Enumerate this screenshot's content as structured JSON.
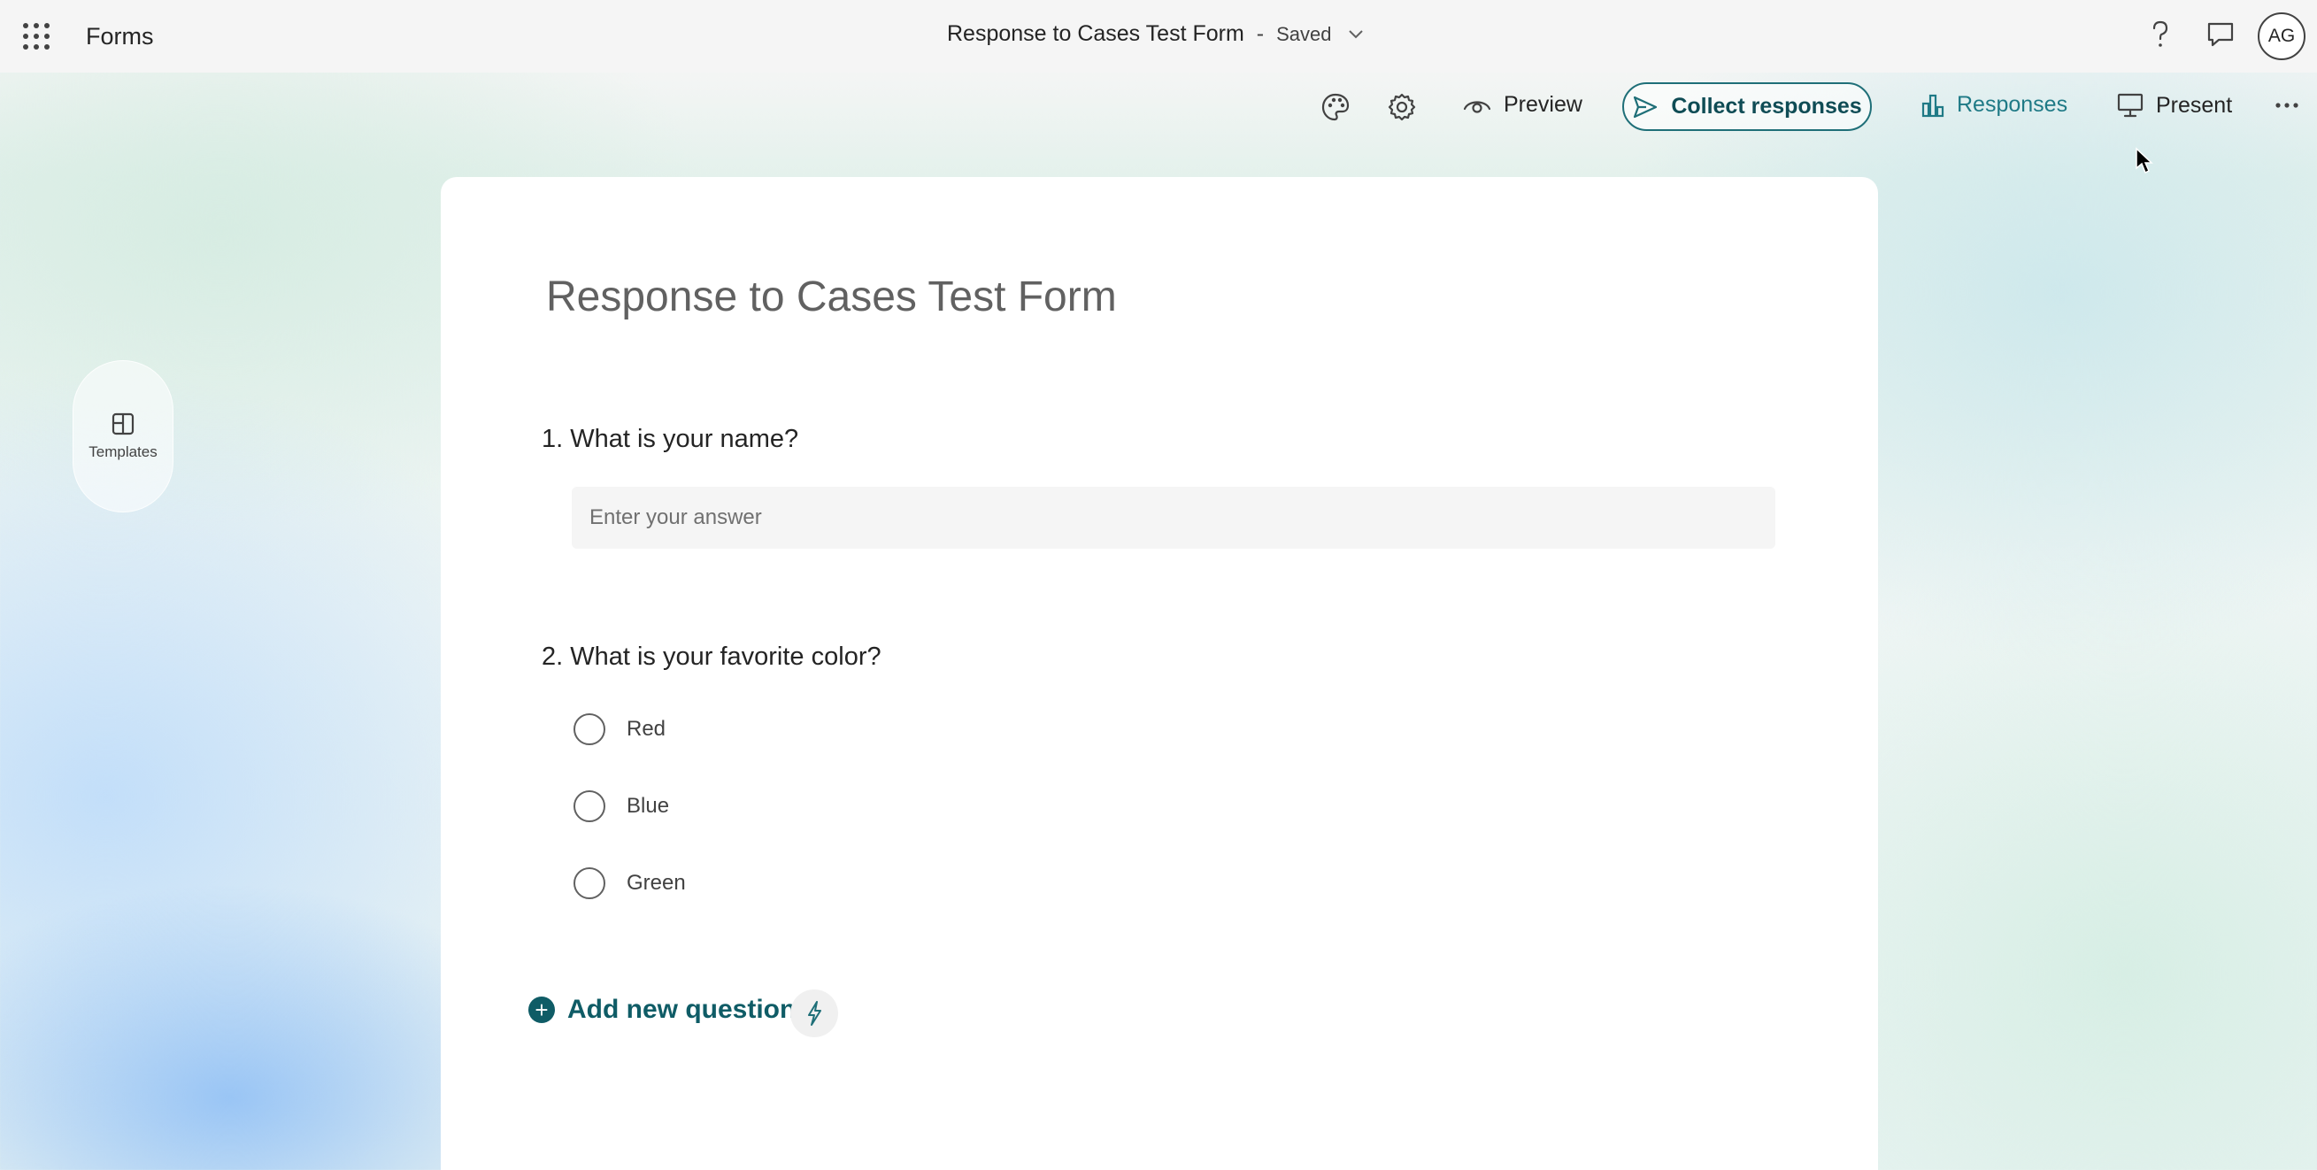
{
  "header": {
    "app_name": "Forms",
    "form_title": "Response to Cases Test Form",
    "separator": "-",
    "save_status": "Saved",
    "user_initials": "AG"
  },
  "toolbar": {
    "preview_label": "Preview",
    "collect_label": "Collect responses",
    "responses_label": "Responses",
    "present_label": "Present"
  },
  "sidebar": {
    "templates_label": "Templates"
  },
  "form": {
    "title": "Response to Cases Test Form",
    "questions": [
      {
        "number": "1.",
        "text": "What is your name?",
        "placeholder": "Enter your answer"
      },
      {
        "number": "2.",
        "text": "What is your favorite color?",
        "options": [
          "Red",
          "Blue",
          "Green"
        ]
      }
    ],
    "add_question_label": "Add new question"
  },
  "icons": {
    "app_launcher": "waffle-icon",
    "help": "help-icon",
    "feedback": "feedback-icon",
    "theme": "palette-icon",
    "settings": "gear-icon",
    "preview": "eye-icon",
    "collect": "send-icon",
    "responses": "bar-chart-icon",
    "present": "monitor-icon",
    "more": "more-icon",
    "templates": "layout-icon",
    "add": "plus-circle-icon",
    "quick_start": "lightning-icon"
  },
  "colors": {
    "accent": "#0f5c66",
    "responses_text": "#1f7a86",
    "collect_border": "#1f6f78"
  }
}
